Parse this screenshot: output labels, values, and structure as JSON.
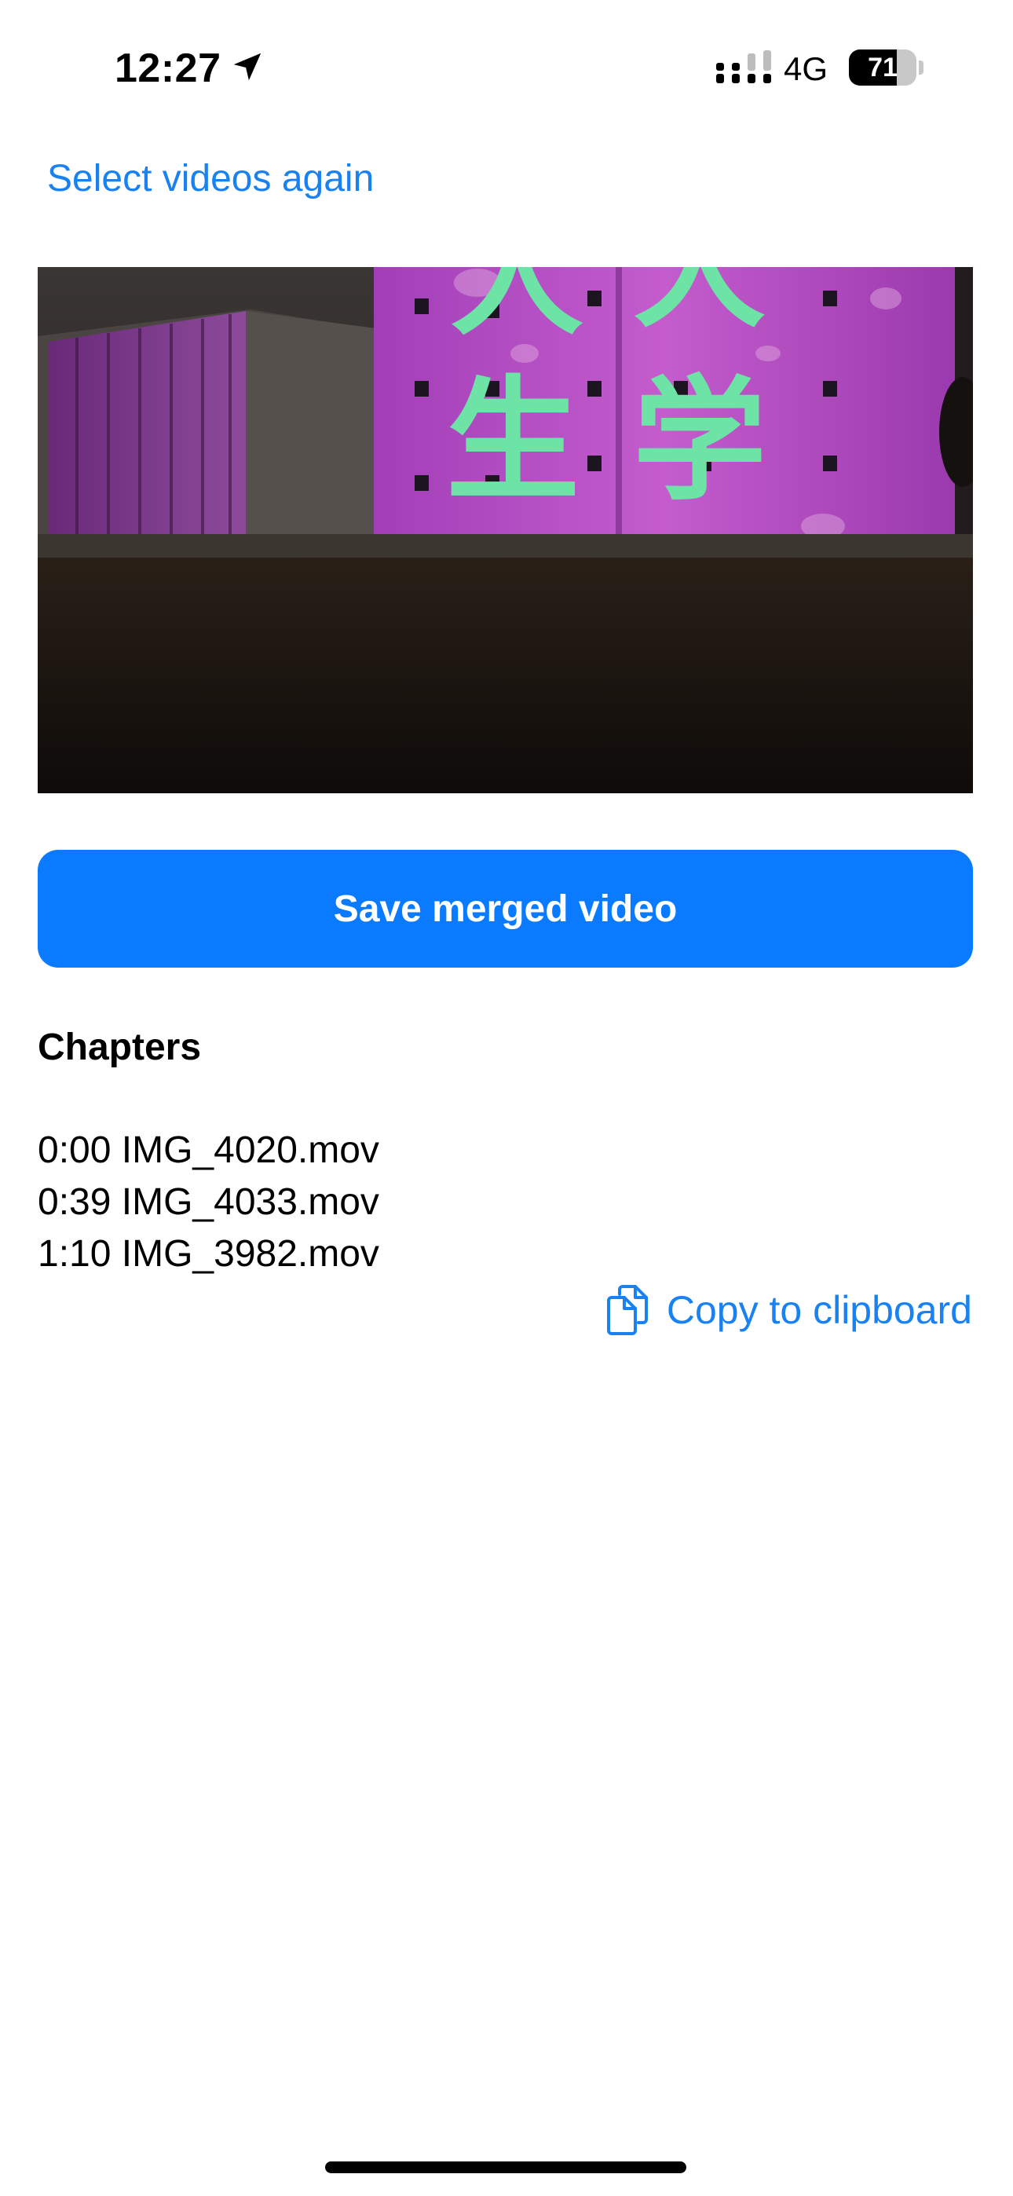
{
  "status_bar": {
    "time": "12:27",
    "network": "4G",
    "battery_level": "71",
    "battery_fraction": 0.71,
    "icons": [
      "location-arrow-icon",
      "cellular-signal-icon",
      "battery-icon"
    ]
  },
  "nav": {
    "select_again_label": "Select videos again"
  },
  "video": {
    "overlay_text": [
      "人",
      "大",
      "生",
      "学"
    ]
  },
  "actions": {
    "save_label": "Save merged video",
    "copy_label": "Copy to clipboard",
    "copy_icon": "clipboard-icon"
  },
  "chapters": {
    "heading": "Chapters",
    "items": [
      {
        "time": "0:00",
        "file": "IMG_4020.mov"
      },
      {
        "time": "0:39",
        "file": "IMG_4033.mov"
      },
      {
        "time": "1:10",
        "file": "IMG_3982.mov"
      }
    ]
  },
  "colors": {
    "accent": "#0a7bff",
    "link": "#1a82f0",
    "background": "#ffffff"
  }
}
